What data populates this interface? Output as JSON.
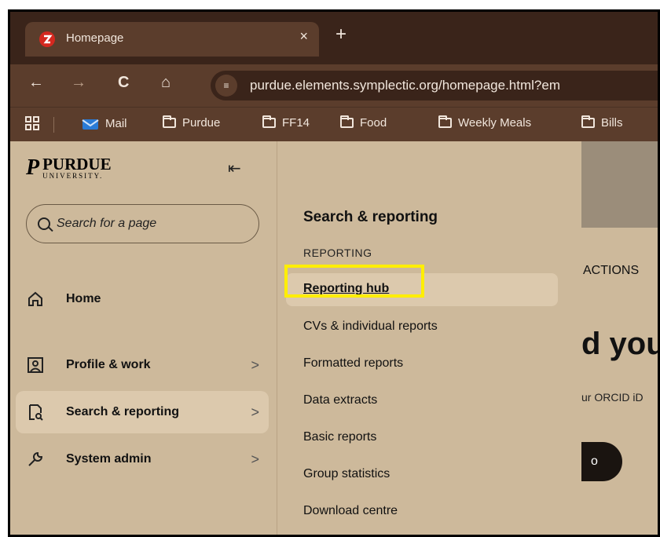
{
  "browser": {
    "tab_title": "Homepage",
    "tab_close": "×",
    "new_tab": "+",
    "back": "←",
    "forward": "→",
    "reload": "C",
    "home": "⌂",
    "url": "purdue.elements.symplectic.org/homepage.html?em",
    "bookmarks": [
      "Mail",
      "Purdue",
      "FF14",
      "Food",
      "Weekly Meals",
      "Bills"
    ]
  },
  "sidebar": {
    "logo_mark": "P",
    "logo_line1": "PURDUE",
    "logo_line2": "UNIVERSITY.",
    "search_placeholder": "Search for a page",
    "items": [
      {
        "label": "Home",
        "icon": "home-icon"
      },
      {
        "label": "Profile & work",
        "icon": "profile-icon",
        "chevron": ">"
      },
      {
        "label": "Search & reporting",
        "icon": "report-search-icon",
        "chevron": ">",
        "active": true
      },
      {
        "label": "System admin",
        "icon": "wrench-icon",
        "chevron": ">"
      }
    ]
  },
  "submenu": {
    "title": "Search & reporting",
    "section": "REPORTING",
    "items": [
      "Reporting hub",
      "CVs & individual reports",
      "Formatted reports",
      "Data extracts",
      "Basic reports",
      "Group statistics",
      "Download centre"
    ]
  },
  "main": {
    "actions_label": "ACTIONS",
    "heading_fragment": "d you",
    "subtext_fragment": "ur ORCID iD",
    "button_fragment": "o"
  },
  "colors": {
    "chrome_dark": "#3a241a",
    "chrome": "#5b3d2c",
    "page_bg": "#cdb99b",
    "highlight": "#ffee00"
  }
}
